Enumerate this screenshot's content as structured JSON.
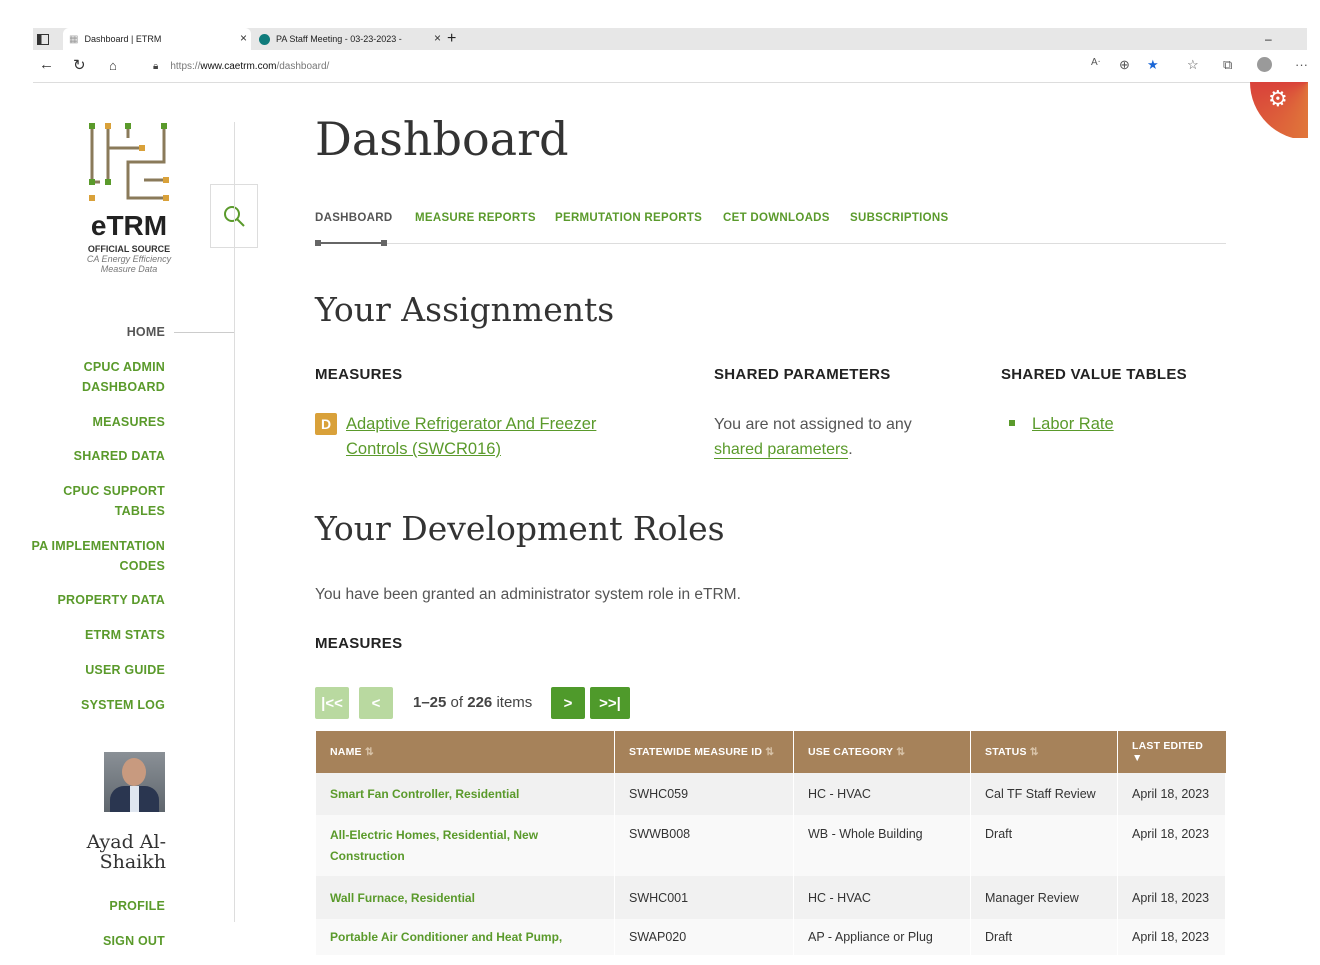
{
  "browser": {
    "tabs": [
      {
        "title": "Dashboard | ETRM",
        "active": true
      },
      {
        "title": "PA Staff Meeting - 03-23-2023 - ",
        "active": false
      }
    ],
    "url_prefix": "https://",
    "url_host": "www.caetrm.com",
    "url_path": "/dashboard/"
  },
  "logo": {
    "name": "eTRM",
    "tagline": "OFFICIAL SOURCE",
    "subtitle_line1": "CA Energy Efficiency",
    "subtitle_line2": "Measure Data"
  },
  "sidebar": {
    "items": [
      {
        "label": "HOME",
        "lines": [
          "HOME"
        ]
      },
      {
        "label": "CPUC ADMIN DASHBOARD",
        "lines": [
          "CPUC ADMIN",
          "DASHBOARD"
        ]
      },
      {
        "label": "MEASURES",
        "lines": [
          "MEASURES"
        ]
      },
      {
        "label": "SHARED DATA",
        "lines": [
          "SHARED DATA"
        ]
      },
      {
        "label": "CPUC SUPPORT TABLES",
        "lines": [
          "CPUC SUPPORT",
          "TABLES"
        ]
      },
      {
        "label": "PA IMPLEMENTATION CODES",
        "lines": [
          "PA IMPLEMENTATION",
          "CODES"
        ]
      },
      {
        "label": "PROPERTY DATA",
        "lines": [
          "PROPERTY DATA"
        ]
      },
      {
        "label": "ETRM STATS",
        "lines": [
          "ETRM STATS"
        ]
      },
      {
        "label": "USER GUIDE",
        "lines": [
          "USER GUIDE"
        ]
      },
      {
        "label": "SYSTEM LOG",
        "lines": [
          "SYSTEM LOG"
        ]
      }
    ],
    "user": {
      "name_line1": "Ayad Al-",
      "name_line2": "Shaikh"
    },
    "profile": "PROFILE",
    "signout": "SIGN OUT"
  },
  "main": {
    "title": "Dashboard",
    "tabs": [
      "DASHBOARD",
      "MEASURE REPORTS",
      "PERMUTATION REPORTS",
      "CET DOWNLOADS",
      "SUBSCRIPTIONS"
    ],
    "assignments": {
      "heading": "Your Assignments",
      "measures_heading": "MEASURES",
      "measure_badge": "D",
      "measure_link_line1": "Adaptive Refrigerator And Freezer",
      "measure_link_line2": "Controls (SWCR016)",
      "shared_params_heading": "SHARED PARAMETERS",
      "shared_params_text": "You are not assigned to any",
      "shared_params_link": "shared parameters",
      "shared_params_end": ".",
      "shared_tables_heading": "SHARED VALUE TABLES",
      "shared_tables_link": "Labor Rate"
    },
    "roles": {
      "heading": "Your Development Roles",
      "text": "You have been granted an administrator system role in eTRM.",
      "measures_heading": "MEASURES"
    },
    "pagination": {
      "range": "1–25",
      "of": "of",
      "total": "226",
      "items": "items",
      "first": "|<<",
      "prev": "<",
      "next": ">",
      "last": ">>|"
    },
    "table": {
      "columns": [
        "NAME",
        "STATEWIDE MEASURE ID",
        "USE CATEGORY",
        "STATUS",
        "LAST EDITED"
      ],
      "rows": [
        {
          "name": "Smart Fan Controller, Residential",
          "name2": "",
          "id": "SWHC059",
          "category": "HC - HVAC",
          "status": "Cal TF Staff Review",
          "edited": "April 18, 2023"
        },
        {
          "name": "All-Electric Homes, Residential, New",
          "name2": "Construction",
          "id": "SWWB008",
          "category": "WB - Whole Building",
          "status": "Draft",
          "edited": "April 18, 2023"
        },
        {
          "name": "Wall Furnace, Residential",
          "name2": "",
          "id": "SWHC001",
          "category": "HC - HVAC",
          "status": "Manager Review",
          "edited": "April 18, 2023"
        },
        {
          "name": "Portable Air Conditioner and Heat Pump,",
          "name2": "",
          "id": "SWAP020",
          "category": "AP - Appliance or Plug",
          "status": "Draft",
          "edited": "April 18, 2023"
        }
      ]
    }
  },
  "colors": {
    "accent_green": "#5a9a2b",
    "table_header": "#a6825a"
  }
}
